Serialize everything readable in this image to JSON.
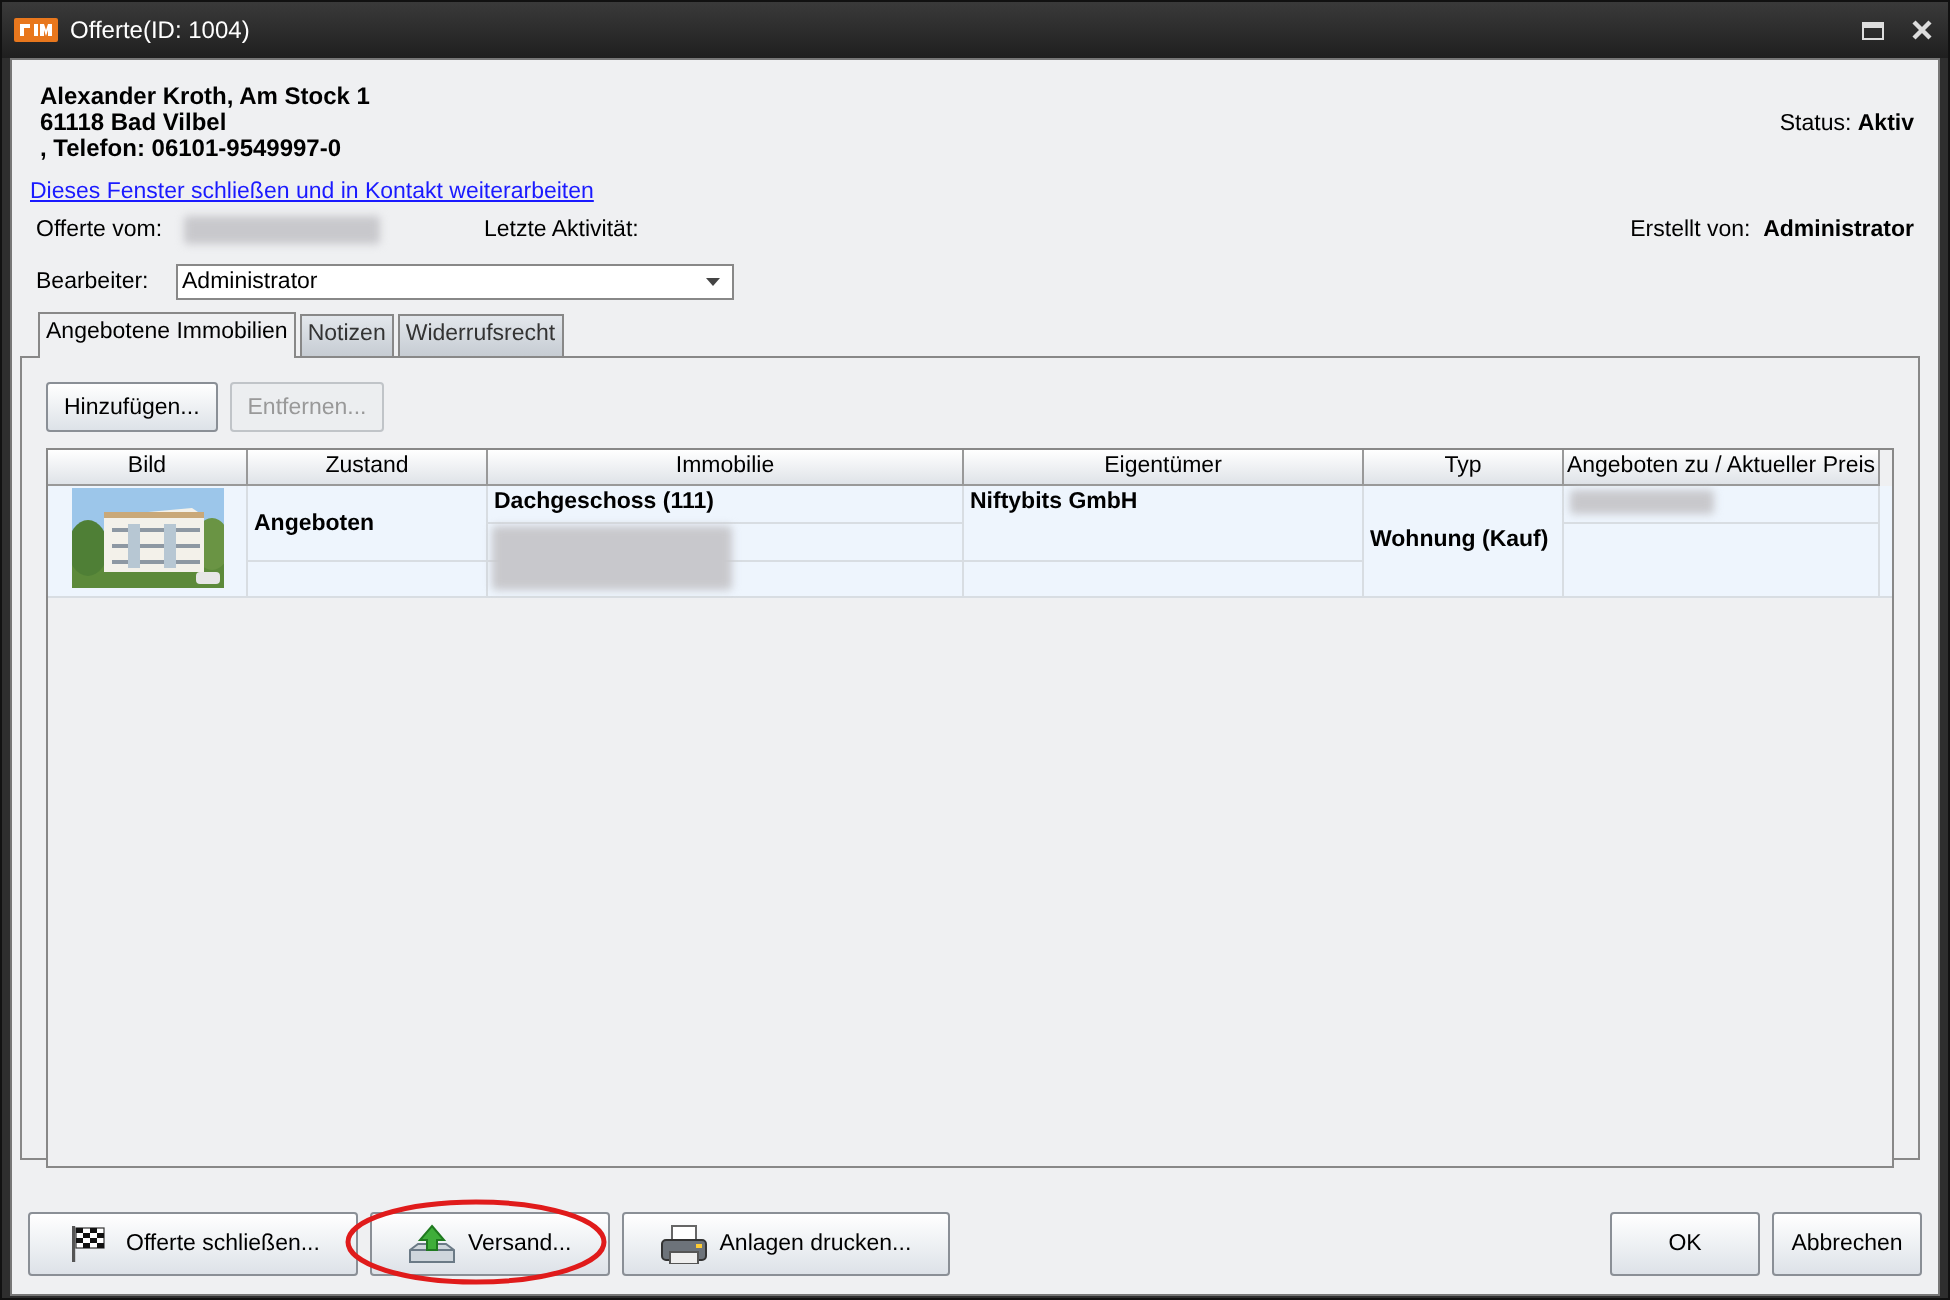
{
  "window": {
    "title": "Offerte(ID: 1004)"
  },
  "contact": {
    "lines": [
      "Alexander Kroth, Am Stock 1",
      "61118 Bad Vilbel",
      ", Telefon: 06101-9549997-0"
    ]
  },
  "status": {
    "label": "Status:",
    "value": "Aktiv"
  },
  "link": "Dieses Fenster schließen und in Kontakt weiterarbeiten",
  "offer_date": {
    "label": "Offerte vom:"
  },
  "last_activity": {
    "label": "Letzte Aktivität:"
  },
  "created_by": {
    "label": "Erstellt von:",
    "value": "Administrator"
  },
  "editor": {
    "label": "Bearbeiter:",
    "value": "Administrator"
  },
  "tabs": [
    {
      "label": "Angebotene Immobilien",
      "selected": true
    },
    {
      "label": "Notizen",
      "selected": false
    },
    {
      "label": "Widerrufsrecht",
      "selected": false
    }
  ],
  "toolbar": [
    {
      "label": "Hinzufügen...",
      "disabled": false
    },
    {
      "label": "Entfernen...",
      "disabled": true
    }
  ],
  "table": {
    "columns": [
      "Bild",
      "Zustand",
      "Immobilie",
      "Eigentümer",
      "Typ",
      "Angeboten zu / Aktueller Preis"
    ],
    "rows": [
      {
        "zustand": "Angeboten",
        "immobilie": "Dachgeschoss (111)",
        "eigentuemer": "Niftybits GmbH",
        "typ": "Wohnung (Kauf)"
      }
    ]
  },
  "footer": {
    "left": [
      {
        "label": "Offerte schließen...",
        "kind": "flag",
        "highlighted": false
      },
      {
        "label": "Versand...",
        "kind": "upload",
        "highlighted": true
      },
      {
        "label": "Anlagen drucken...",
        "kind": "printer",
        "highlighted": false
      }
    ],
    "right": [
      "OK",
      "Abbrechen"
    ]
  }
}
